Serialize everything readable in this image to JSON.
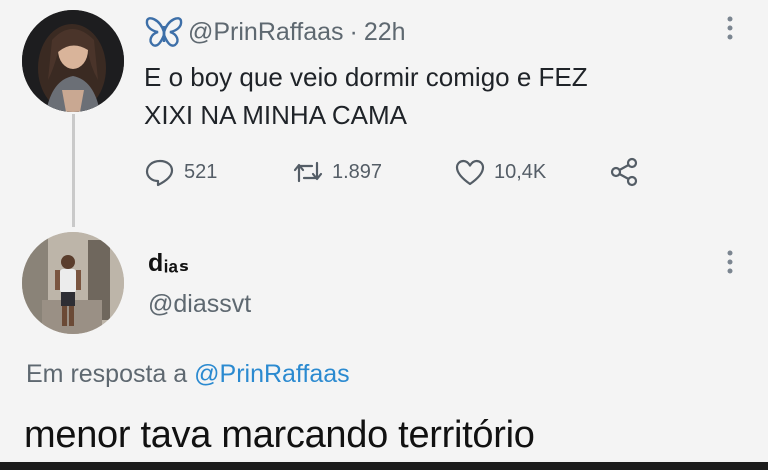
{
  "tweet": {
    "author_handle": "@PrinRaffaas",
    "separator": "·",
    "time": "22h",
    "text_line1": "E o boy que veio dormir comigo e FEZ",
    "text_line2": "XIXI NA MINHA CAMA",
    "stats": {
      "replies": "521",
      "retweets": "1.897",
      "likes": "10,4K"
    }
  },
  "reply": {
    "display_name": "dᵢₐₛ",
    "handle": "@diassvt",
    "in_reply_prefix": "Em resposta a",
    "in_reply_mention": "@PrinRaffaas",
    "text": "menor tava marcando território"
  },
  "colors": {
    "background": "#f4f4f4",
    "butterfly": "#3d6fa8",
    "mention": "#2b8ad0",
    "muted_text": "#5e6870"
  },
  "icons": [
    "butterfly-icon",
    "reply-icon",
    "retweet-icon",
    "like-icon",
    "share-icon",
    "more-icon"
  ]
}
